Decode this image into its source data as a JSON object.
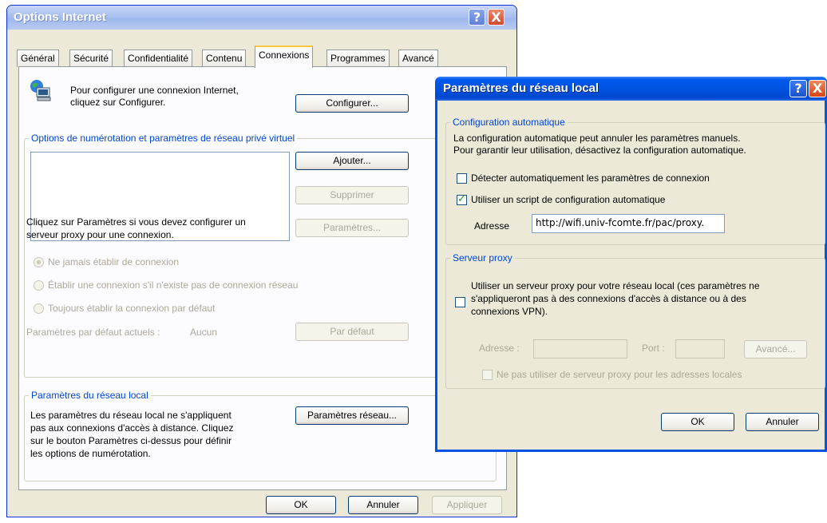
{
  "win1": {
    "title": "Options Internet",
    "help_btn": "?",
    "close_btn": "X",
    "tabs": [
      "Général",
      "Sécurité",
      "Confidentialité",
      "Contenu",
      "Connexions",
      "Programmes",
      "Avancé"
    ],
    "setup_text_1": "Pour configurer une connexion Internet,",
    "setup_text_2": "cliquez sur Configurer.",
    "configure_btn": "Configurer...",
    "dialup_group": "Options de numérotation et paramètres de réseau privé virtuel",
    "add_btn": "Ajouter...",
    "remove_btn": "Supprimer",
    "proxy_text_1": "Cliquez sur Paramètres si vous devez configurer un",
    "proxy_text_2": "serveur proxy pour une connexion.",
    "settings_btn": "Paramètres...",
    "radio_never": "Ne jamais établir de connexion",
    "radio_when_needed": "Établir une connexion s'il n'existe pas de connexion réseau",
    "radio_always": "Toujours établir la connexion par défaut",
    "default_label": "Paramètres par défaut actuels :",
    "default_value": "Aucun",
    "set_default_btn": "Par défaut",
    "lan_group": "Paramètres du réseau local",
    "lan_text": [
      "Les paramètres du réseau local ne s'appliquent",
      "pas aux connexions d'accès à distance. Cliquez",
      "sur le bouton Paramètres ci-dessus pour définir",
      "les options de numérotation."
    ],
    "lan_settings_btn": "Paramètres réseau...",
    "ok_btn": "OK",
    "cancel_btn": "Annuler",
    "apply_btn": "Appliquer"
  },
  "win2": {
    "title": "Paramètres du réseau local",
    "help_btn": "?",
    "close_btn": "X",
    "auto_group": "Configuration automatique",
    "auto_text_1": "La configuration automatique peut annuler les paramètres manuels.",
    "auto_text_2": "Pour garantir leur utilisation, désactivez la configuration automatique.",
    "detect_label": "Détecter automatiquement les paramètres de connexion",
    "script_label": "Utiliser un script de configuration automatique",
    "address_label": "Adresse",
    "address_value": "http://wifi.univ-fcomte.fr/pac/proxy.",
    "proxy_group": "Serveur proxy",
    "proxy_text": [
      "Utiliser un serveur proxy pour votre réseau local (ces paramètres ne",
      "s'appliqueront pas à des connexions d'accès à distance ou à des",
      "connexions VPN)."
    ],
    "proxy_address_label": "Adresse :",
    "port_label": "Port :",
    "advanced_btn": "Avancé...",
    "bypass_label": "Ne pas utiliser de serveur proxy pour les adresses locales",
    "ok_btn": "OK",
    "cancel_btn": "Annuler"
  }
}
